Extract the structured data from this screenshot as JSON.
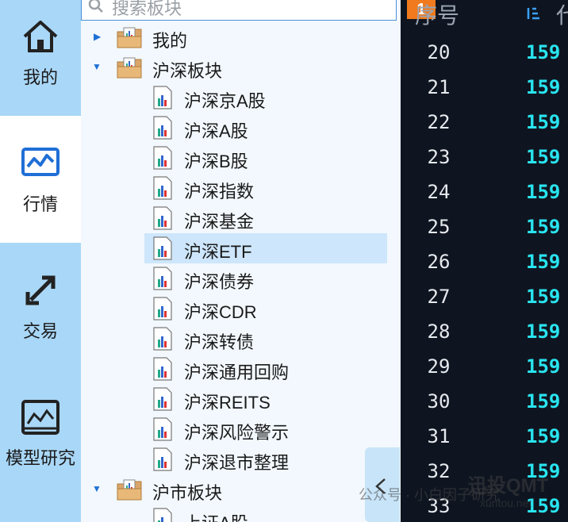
{
  "nav": {
    "items": [
      {
        "label": "我的",
        "icon": "home-icon"
      },
      {
        "label": "行情",
        "icon": "market-chart-icon"
      },
      {
        "label": "交易",
        "icon": "trade-arrows-icon"
      },
      {
        "label": "模型研究",
        "icon": "model-chart-icon"
      }
    ]
  },
  "search": {
    "placeholder": "搜索板块"
  },
  "tree": {
    "rows": [
      {
        "label": "我的",
        "level": 0,
        "expanded": false
      },
      {
        "label": "沪深板块",
        "level": 0,
        "expanded": true
      },
      {
        "label": "沪深京A股",
        "level": 1
      },
      {
        "label": "沪深A股",
        "level": 1
      },
      {
        "label": "沪深B股",
        "level": 1
      },
      {
        "label": "沪深指数",
        "level": 1
      },
      {
        "label": "沪深基金",
        "level": 1
      },
      {
        "label": "沪深ETF",
        "level": 1,
        "selected": true
      },
      {
        "label": "沪深债券",
        "level": 1
      },
      {
        "label": "沪深CDR",
        "level": 1
      },
      {
        "label": "沪深转债",
        "level": 1
      },
      {
        "label": "沪深通用回购",
        "level": 1
      },
      {
        "label": "沪深REITS",
        "level": 1
      },
      {
        "label": "沪深风险警示",
        "level": 1
      },
      {
        "label": "沪深退市整理",
        "level": 1
      },
      {
        "label": "沪市板块",
        "level": 0,
        "expanded": true
      },
      {
        "label": "上证A股",
        "level": 1
      }
    ]
  },
  "table": {
    "badge": "1",
    "header_seq": "序号",
    "header_code": "代",
    "rows": [
      {
        "seq": "20",
        "code": "159"
      },
      {
        "seq": "21",
        "code": "159"
      },
      {
        "seq": "22",
        "code": "159"
      },
      {
        "seq": "23",
        "code": "159"
      },
      {
        "seq": "24",
        "code": "159"
      },
      {
        "seq": "25",
        "code": "159"
      },
      {
        "seq": "26",
        "code": "159"
      },
      {
        "seq": "27",
        "code": "159"
      },
      {
        "seq": "28",
        "code": "159"
      },
      {
        "seq": "29",
        "code": "159"
      },
      {
        "seq": "30",
        "code": "159"
      },
      {
        "seq": "31",
        "code": "159"
      },
      {
        "seq": "32",
        "code": "159"
      },
      {
        "seq": "33",
        "code": "159"
      }
    ]
  },
  "watermark": {
    "line1": "公众号 · 小白因子研究",
    "line2": "迅投QMT",
    "line3": "xuntou.net"
  },
  "colors": {
    "nav_bg": "#a9d7f7",
    "selected_bg": "#cde6fb",
    "code_cyan": "#29e4ef",
    "badge_orange": "#f07a1d",
    "table_bg": "#0f1520"
  }
}
